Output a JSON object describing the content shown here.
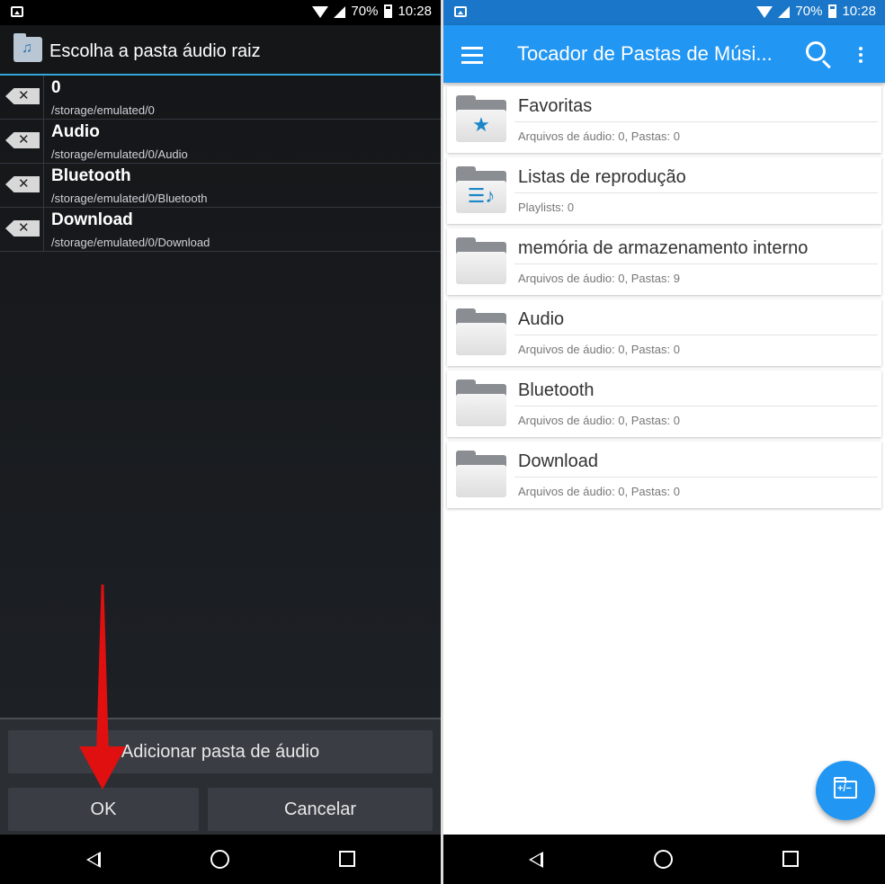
{
  "status_bar": {
    "battery": "70%",
    "time": "10:28"
  },
  "dialog": {
    "title": "Escolha a pasta áudio raiz",
    "folders": [
      {
        "name": "0",
        "path": "/storage/emulated/0"
      },
      {
        "name": "Audio",
        "path": "/storage/emulated/0/Audio"
      },
      {
        "name": "Bluetooth",
        "path": "/storage/emulated/0/Bluetooth"
      },
      {
        "name": "Download",
        "path": "/storage/emulated/0/Download"
      }
    ],
    "add_label": "Adicionar pasta de áudio",
    "ok_label": "OK",
    "cancel_label": "Cancelar"
  },
  "app": {
    "title": "Tocador de Pastas de Músi...",
    "cards": [
      {
        "title": "Favoritas",
        "subtitle": "Arquivos de áudio: 0, Pastas: 0",
        "icon": "star-folder-icon"
      },
      {
        "title": "Listas de reprodução",
        "subtitle": "Playlists: 0",
        "icon": "playlist-folder-icon"
      },
      {
        "title": "memória de armazenamento interno",
        "subtitle": "Arquivos de áudio: 0, Pastas: 9",
        "icon": "folder-icon"
      },
      {
        "title": "Audio",
        "subtitle": "Arquivos de áudio: 0, Pastas: 0",
        "icon": "folder-icon"
      },
      {
        "title": "Bluetooth",
        "subtitle": "Arquivos de áudio: 0, Pastas: 0",
        "icon": "folder-icon"
      },
      {
        "title": "Download",
        "subtitle": "Arquivos de áudio: 0, Pastas: 0",
        "icon": "folder-icon"
      }
    ],
    "accent": "#2196f3"
  },
  "annotation_arrow_color": "#e01010"
}
